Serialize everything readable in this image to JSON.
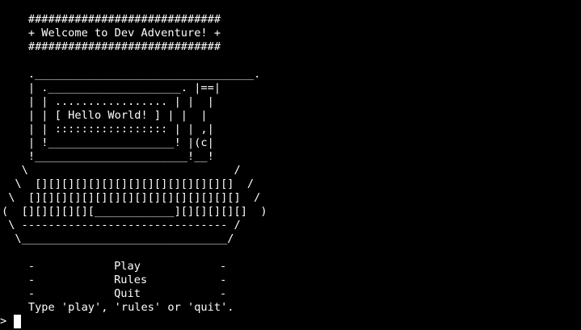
{
  "terminal": {
    "banner": [
      "    #############################",
      "    + Welcome to Dev Adventure! +",
      "    #############################"
    ],
    "computer_art": [
      "    ._________________________________.",
      "    | .____________________. |==|",
      "    | | ................. | |  |",
      "    | | [ Hello World! ] | |  |",
      "    | | ::::::::::::::::: | | ,|",
      "    | !___________________! |(c|",
      "    !_______________________!__!",
      "   \\                               /",
      "  \\  [][][][][][][][][][][][][][][]  /",
      " \\  [][][][][][][][][][][][][][][][]  /",
      "(  [][][][][][____________][][][][][]  )",
      " \\ ------------------------------- /",
      "  \\_______________________________/"
    ],
    "blank": "",
    "menu": [
      {
        "left": "    -",
        "label": "Play",
        "right": "-"
      },
      {
        "left": "    -",
        "label": "Rules",
        "right": "-"
      },
      {
        "left": "    -",
        "label": "Quit",
        "right": "-"
      }
    ],
    "instructions": "    Type 'play', 'rules' or 'quit'.",
    "prompt_symbol": ">"
  }
}
